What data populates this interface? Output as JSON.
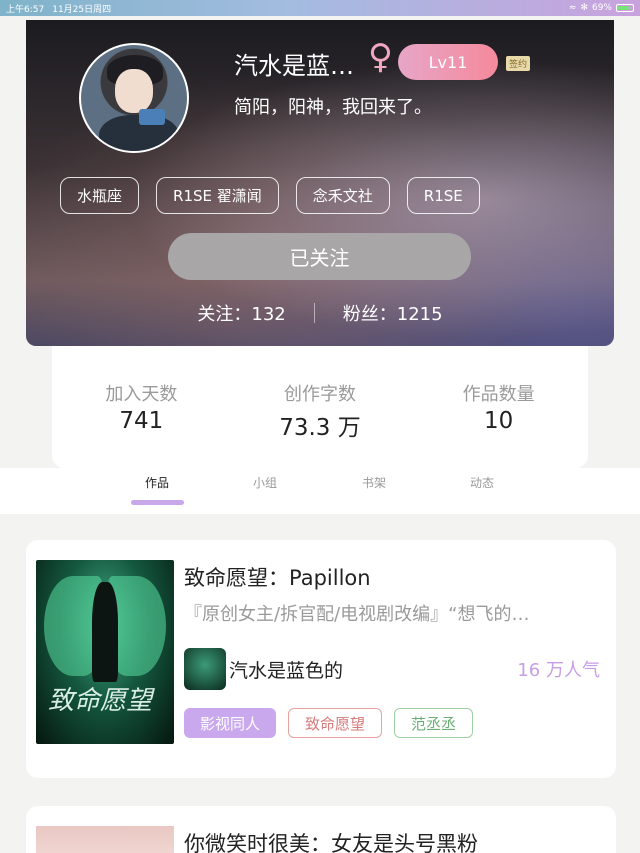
{
  "status_bar": {
    "time": "上午6:57",
    "date": "11月25日周四",
    "battery": "69%"
  },
  "profile": {
    "name": "汽水是蓝…",
    "gender_symbol": "♀",
    "level": "Lv11",
    "sign_badge": "签约",
    "motto": "简阳，阳神，我回来了。",
    "tags": [
      "水瓶座",
      "R1SE 翟潇闻",
      "念禾文社",
      "R1SE"
    ],
    "follow_button": "已关注",
    "following": "关注：132",
    "followers": "粉丝：1215"
  },
  "stats": [
    {
      "label": "加入天数",
      "value": "741"
    },
    {
      "label": "创作字数",
      "value": "73.3 万"
    },
    {
      "label": "作品数量",
      "value": "10"
    }
  ],
  "tabs": [
    "作品",
    "小组",
    "书架",
    "动态"
  ],
  "works": [
    {
      "title": "致命愿望：Papillon",
      "description": "『原创女主/拆官配/电视剧改编』“想飞的…",
      "author": "汽水是蓝色的",
      "popularity": "16 万人气",
      "cover_text": "致命愿望",
      "chips": [
        "影视同人",
        "致命愿望",
        "范丞丞"
      ]
    },
    {
      "title": "你微笑时很美：女友是头号黑粉"
    }
  ]
}
